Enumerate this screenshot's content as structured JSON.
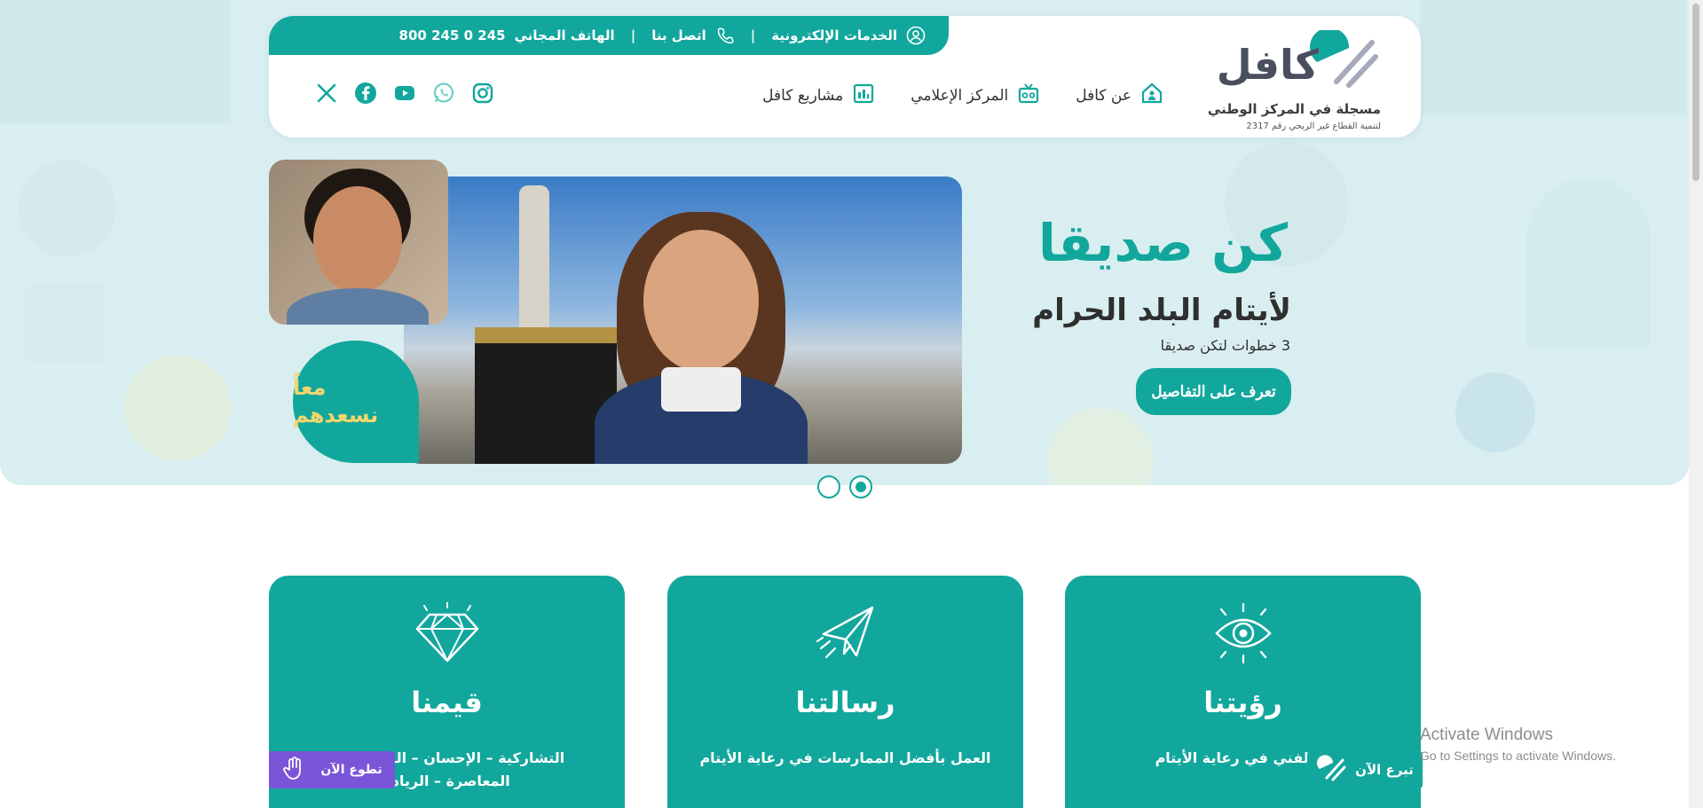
{
  "colors": {
    "accent": "#12a79d",
    "purple": "#7b55d8",
    "gold": "#f2d66b"
  },
  "topbar": {
    "hotline_label": "الهاتف المجاني",
    "hotline_number": "800 245 0 245",
    "separator": "|",
    "contact_label": "اتصل بنا",
    "eservices_label": "الخدمات الإلكترونية"
  },
  "logo": {
    "name": "كافل",
    "line1": "مسجلة في المركز الوطني",
    "line2": "لتنمية القطاع غير الربحي رقم 2317"
  },
  "nav": [
    {
      "label": "عن كافل",
      "icon": "home-icon"
    },
    {
      "label": "المركز الإعلامي",
      "icon": "tv-icon"
    },
    {
      "label": "مشاريع كافل",
      "icon": "projects-icon"
    }
  ],
  "social": [
    "instagram-icon",
    "whatsapp-icon",
    "youtube-icon",
    "facebook-icon",
    "x-icon"
  ],
  "hero": {
    "title": "كن صديقا",
    "subtitle": "لأيتام البلد الحرام",
    "small": "3 خطوات لتكن صديقا",
    "button": "تعرف على التفاصيل",
    "badge_line1": "معاً",
    "badge_line2": "نسعدهم"
  },
  "slider": {
    "count": 2,
    "active": 2
  },
  "cards": [
    {
      "title": "رؤيتنا",
      "text": "ن الفني في رعاية الأيتام",
      "icon": "eye-icon"
    },
    {
      "title": "رسالتنا",
      "text": "العمل بأفضل الممارسات في رعاية الأيتام",
      "icon": "paper-plane-icon"
    },
    {
      "title": "قيمنا",
      "text": "التشاركية – الإحسان – المسؤ ... ة",
      "text2": "المعاصرة – الريادة",
      "icon": "diamond-icon"
    }
  ],
  "floating": {
    "volunteer": "تطوع الآن",
    "donate": "تبرع الآن"
  },
  "windows": {
    "line1": "Activate Windows",
    "line2": "Go to Settings to activate Windows."
  }
}
